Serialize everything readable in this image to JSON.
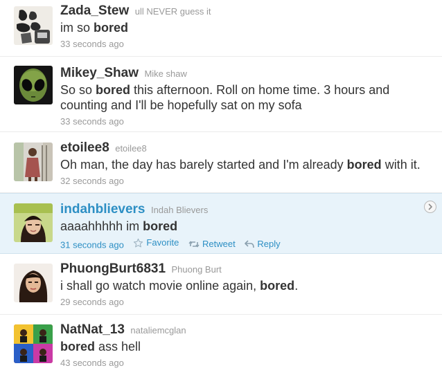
{
  "tweets": [
    {
      "screen_name": "Zada_Stew",
      "full_name": "ull NEVER guess it",
      "text_before": "im so ",
      "bold": "bored",
      "text_after": "",
      "time": "33 seconds ago"
    },
    {
      "screen_name": "Mikey_Shaw",
      "full_name": "Mike shaw",
      "text_before": "So so ",
      "bold": "bored",
      "text_after": " this afternoon. Roll on home time. 3 hours and counting and I'll be hopefully sat on my sofa",
      "time": "33 seconds ago"
    },
    {
      "screen_name": "etoilee8",
      "full_name": "etoilee8",
      "text_before": "Oh man, the day has barely started and I'm already ",
      "bold": "bored",
      "text_after": " with it.",
      "time": "32 seconds ago"
    },
    {
      "screen_name": "indahblievers",
      "full_name": "Indah Blievers",
      "text_before": "aaaahhhhh im ",
      "bold": "bored",
      "text_after": "",
      "time": "31 seconds ago",
      "actions": {
        "favorite": "Favorite",
        "retweet": "Retweet",
        "reply": "Reply"
      }
    },
    {
      "screen_name": "PhuongBurt6831",
      "full_name": "Phuong Burt",
      "text_before": "i shall go watch movie online again, ",
      "bold": "bored",
      "text_after": ".",
      "time": "29 seconds ago"
    },
    {
      "screen_name": "NatNat_13",
      "full_name": "nataliemcglan",
      "text_before": "",
      "bold": "bored",
      "text_after": " ass hell",
      "time": "43 seconds ago"
    }
  ],
  "icons": {
    "favorite": "star-icon",
    "retweet": "retweet-icon",
    "reply": "reply-arrow-icon",
    "expand": "chevron-right-icon"
  },
  "colors": {
    "link_blue": "#2d8fc4",
    "highlight_bg": "#e8f3fa",
    "muted": "#999999",
    "text": "#333333"
  }
}
